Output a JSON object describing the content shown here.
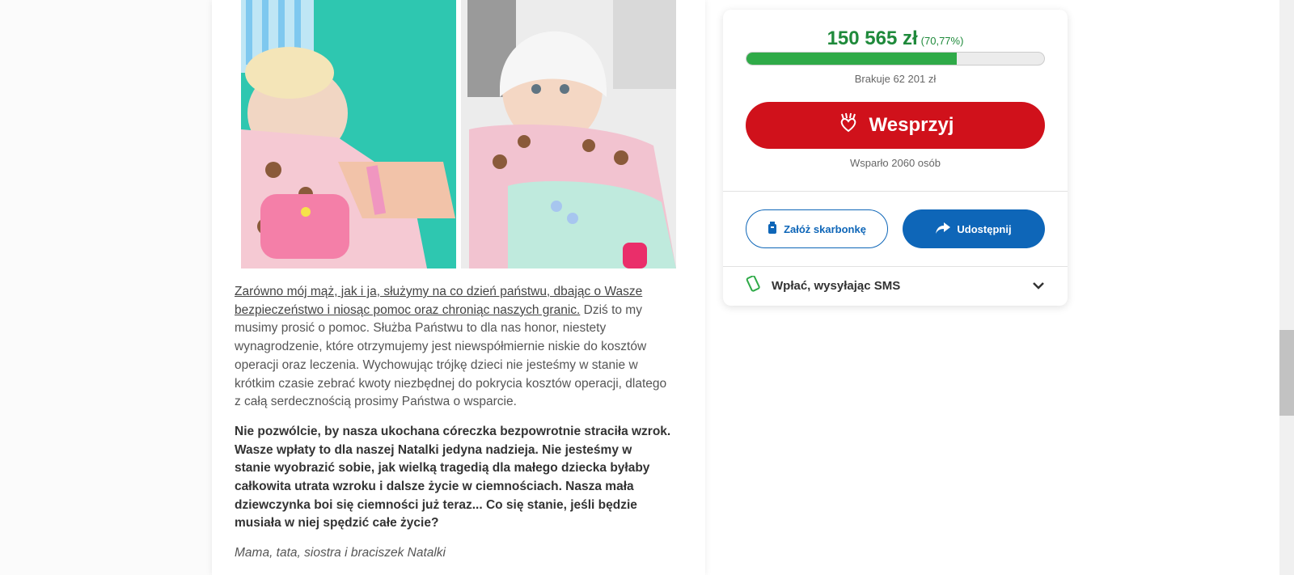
{
  "story": {
    "p1_link": "Zarówno mój mąż, jak i ja, służymy na co dzień państwu, dbając o Wasze bezpieczeństwo i niosąc pomoc oraz chroniąc naszych granic.",
    "p1_rest": " Dziś to my musimy prosić o pomoc. Służba Państwu to dla nas honor, niestety wynagrodzenie, które otrzymujemy jest niewspółmiernie niskie do kosztów operacji oraz leczenia. Wychowując trójkę dzieci nie jesteśmy w stanie w krótkim czasie zebrać kwoty niezbędnej do pokrycia kosztów operacji, dlatego z całą serdecznością prosimy Państwa o wsparcie.",
    "p2": "Nie pozwólcie, by nasza ukochana córeczka bezpowrotnie straciła wzrok. Wasze wpłaty to dla naszej Natalki jedyna nadzieja. Nie jesteśmy w stanie wyobrazić sobie, jak wielką tragedią dla małego dziecka byłaby całkowita utrata wzroku i dalsze życie w ciemnościach. Nasza mała dziewczynka boi się ciemności już teraz... Co się stanie, jeśli będzie musiała w niej spędzić całe życie?",
    "signature": "Mama, tata, siostra i braciszek Natalki"
  },
  "donation": {
    "amount": "150 565 zł",
    "percent": "(70,77%)",
    "progress_fraction": 0.7077,
    "missing": "Brakuje 62 201 zł",
    "support_label": "Wesprzyj",
    "supporters": "Wsparło 2060 osób",
    "piggy_label": "Załóż skarbonkę",
    "share_label": "Udostępnij",
    "sms_label": "Wpłać, wysyłając SMS"
  },
  "colors": {
    "accent_red": "#d0111b",
    "accent_blue": "#0e66b8",
    "progress_green": "#2faa48",
    "amount_green": "#1f8a3b"
  },
  "icons": {
    "support": "heart-hands-icon",
    "piggy": "piggy-bank-icon",
    "share": "share-arrow-icon",
    "sms": "phone-icon",
    "expand": "chevron-down-icon"
  }
}
